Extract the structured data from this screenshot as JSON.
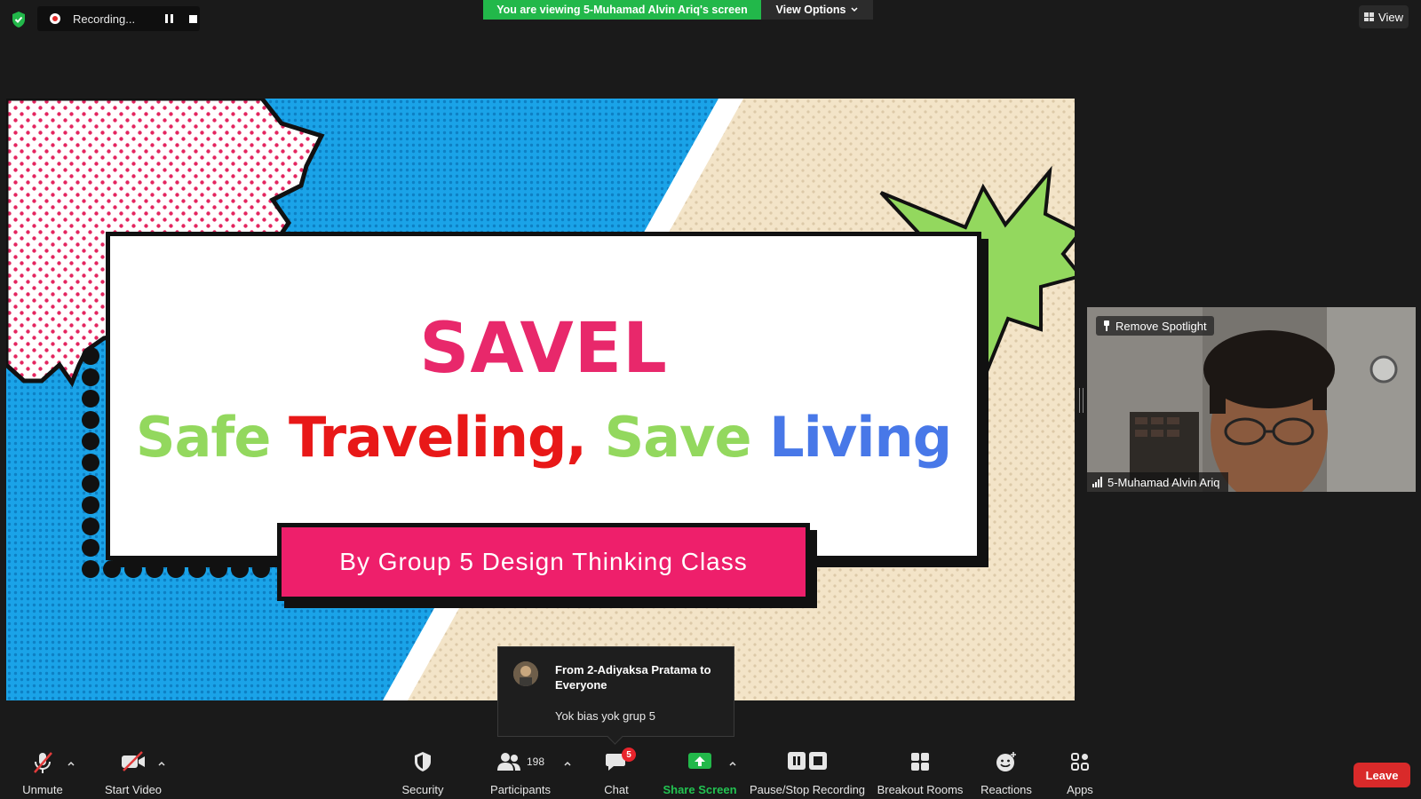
{
  "topbar": {
    "recording_label": "Recording...",
    "viewing_banner": "You are viewing 5-Muhamad Alvin Ariq's screen",
    "view_options": "View Options",
    "view_button": "View"
  },
  "slide": {
    "title": "SAVEL",
    "subtitle_words": [
      "Safe",
      "Traveling,",
      "Save",
      "Living"
    ],
    "byline": "By Group 5 Design Thinking Class"
  },
  "participant": {
    "spotlight_label": "Remove Spotlight",
    "name": "5-Muhamad Alvin Ariq"
  },
  "chat_popup": {
    "from": "From 2-Adiyaksa Pratama to Everyone",
    "message": "Yok bias yok grup 5"
  },
  "toolbar": {
    "unmute": "Unmute",
    "start_video": "Start Video",
    "security": "Security",
    "participants": "Participants",
    "participants_count": "198",
    "chat": "Chat",
    "chat_badge": "5",
    "share_screen": "Share Screen",
    "pause_stop_recording": "Pause/Stop Recording",
    "breakout_rooms": "Breakout Rooms",
    "reactions": "Reactions",
    "apps": "Apps",
    "leave": "Leave"
  },
  "colors": {
    "share_green": "#22b84a",
    "leave_red": "#d92a2a",
    "slide_pink": "#ee1f6b",
    "slide_blue": "#1aa3e8",
    "slide_lime": "#93d85e"
  }
}
